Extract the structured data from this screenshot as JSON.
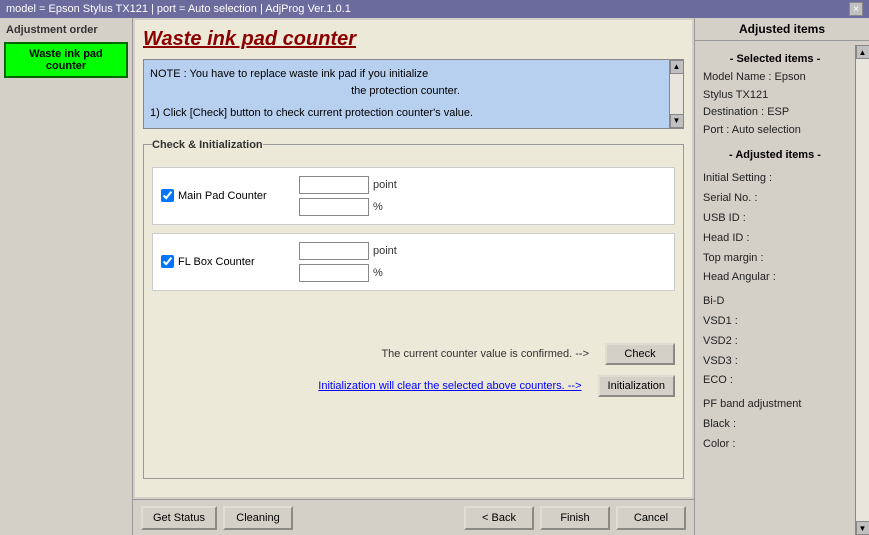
{
  "titleBar": {
    "text": "model = Epson Stylus TX121 | port = Auto selection | AdjProg Ver.1.0.1",
    "closeBtn": "×"
  },
  "sidebar": {
    "title": "Adjustment order",
    "items": [
      {
        "id": "waste-ink-pad-counter",
        "label": "Waste ink pad counter"
      }
    ]
  },
  "pageTitle": "Waste ink pad counter",
  "noteBox": {
    "line1": "NOTE : You have to replace waste ink pad if you initialize",
    "line2": "the protection counter.",
    "line3": "",
    "line4": "1) Click [Check] button to check current protection counter's value."
  },
  "checkGroup": {
    "legend": "Check & Initialization",
    "counters": [
      {
        "id": "main-pad-counter",
        "checked": true,
        "label": "Main Pad Counter",
        "pointValue": "",
        "percentValue": ""
      },
      {
        "id": "fl-box-counter",
        "checked": true,
        "label": "FL Box Counter",
        "pointValue": "",
        "percentValue": ""
      }
    ]
  },
  "actions": {
    "checkText": "The current counter value is confirmed. -->",
    "checkBtn": "Check",
    "initText": "Initialization will clear the selected above counters. -->",
    "initBtn": "Initialization"
  },
  "bottomBar": {
    "getStatusBtn": "Get Status",
    "cleaningBtn": "Cleaning",
    "backBtn": "< Back",
    "finishBtn": "Finish",
    "cancelBtn": "Cancel"
  },
  "rightPanel": {
    "title": "Adjusted items",
    "selectedTitle": "- Selected items -",
    "modelName": "Model Name : Epson",
    "modelName2": "Stylus TX121",
    "destination": "Destination : ESP",
    "port": "Port : Auto selection",
    "adjustedTitle": "- Adjusted items -",
    "fields": [
      {
        "label": "Initial Setting :"
      },
      {
        "label": ""
      },
      {
        "label": "Serial No. :"
      },
      {
        "label": ""
      },
      {
        "label": "USB ID :"
      },
      {
        "label": ""
      },
      {
        "label": "Head ID :"
      },
      {
        "label": ""
      },
      {
        "label": "Top margin :"
      },
      {
        "label": ""
      },
      {
        "label": "Head Angular :"
      },
      {
        "label": ""
      },
      {
        "label": "Bi-D"
      },
      {
        "label": " VSD1 :"
      },
      {
        "label": " VSD2 :"
      },
      {
        "label": " VSD3 :"
      },
      {
        "label": " ECO  :"
      },
      {
        "label": ""
      },
      {
        "label": "PF band adjustment"
      },
      {
        "label": "Black :"
      },
      {
        "label": "Color :"
      }
    ]
  }
}
